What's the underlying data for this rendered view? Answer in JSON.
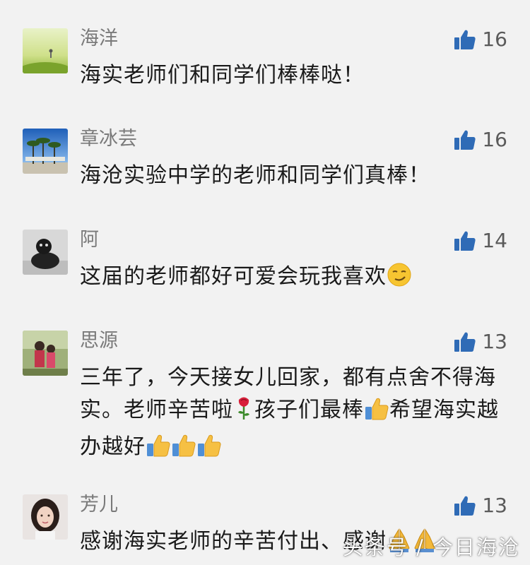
{
  "comments": [
    {
      "user": "海洋",
      "likes": "16",
      "text": "海实老师们和同学们棒棒哒！"
    },
    {
      "user": "章冰芸",
      "likes": "16",
      "text": "海沧实验中学的老师和同学们真棒！"
    },
    {
      "user": "阿",
      "likes": "14",
      "text": "这届的老师都好可爱会玩我喜欢"
    },
    {
      "user": "思源",
      "likes": "13",
      "text_part1": "三年了，今天接女儿回家，都有点舍不得海实。老师辛苦啦",
      "text_part2": "孩子们最棒",
      "text_part3": "希望海实越办越好"
    },
    {
      "user": "芳儿",
      "likes": "13",
      "text": "感谢海实老师的辛苦付出、感谢"
    }
  ],
  "watermark": "头条号 / 今日海沧",
  "colors": {
    "like_icon": "#2f6bb6",
    "background": "#f2f2f2"
  },
  "icons": {
    "like": "thumbs-up-icon",
    "smirk": "smirk-emoji",
    "rose": "rose-emoji",
    "thumbs": "thumbs-up-emoji",
    "pray": "folded-hands-emoji"
  }
}
